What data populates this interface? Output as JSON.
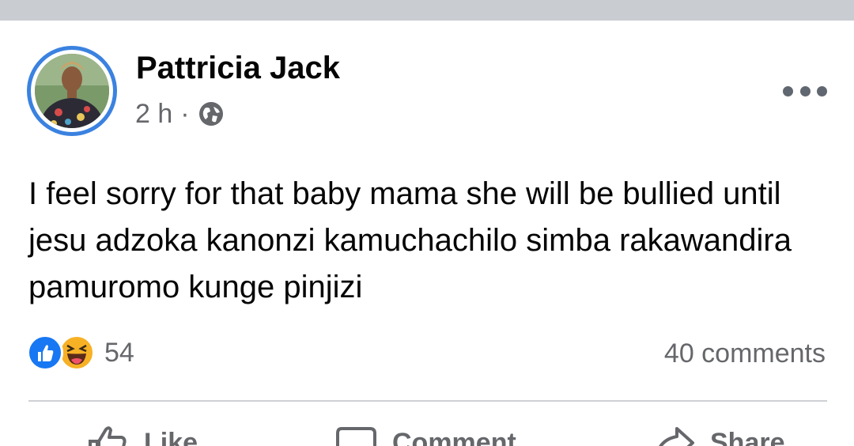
{
  "post": {
    "author": "Pattricia Jack",
    "time": "2 h",
    "separator": "·",
    "privacy_icon": "globe-icon",
    "text": "I feel sorry for that baby mama she will be bullied until jesu adzoka kanonzi kamuchachilo simba rakawandira pamuromo kunge pinjizi",
    "reactions": {
      "icons": [
        "like-reaction-icon",
        "haha-reaction-icon"
      ],
      "count": "54"
    },
    "comments": "40 comments",
    "actions": {
      "like": "Like",
      "comment": "Comment",
      "share": "Share"
    }
  },
  "colors": {
    "accent": "#1877f2",
    "avatar_ring": "#3b82e0",
    "secondary_text": "#65676b",
    "top_strip": "#c9ccd1",
    "haha": "#f7b125"
  }
}
